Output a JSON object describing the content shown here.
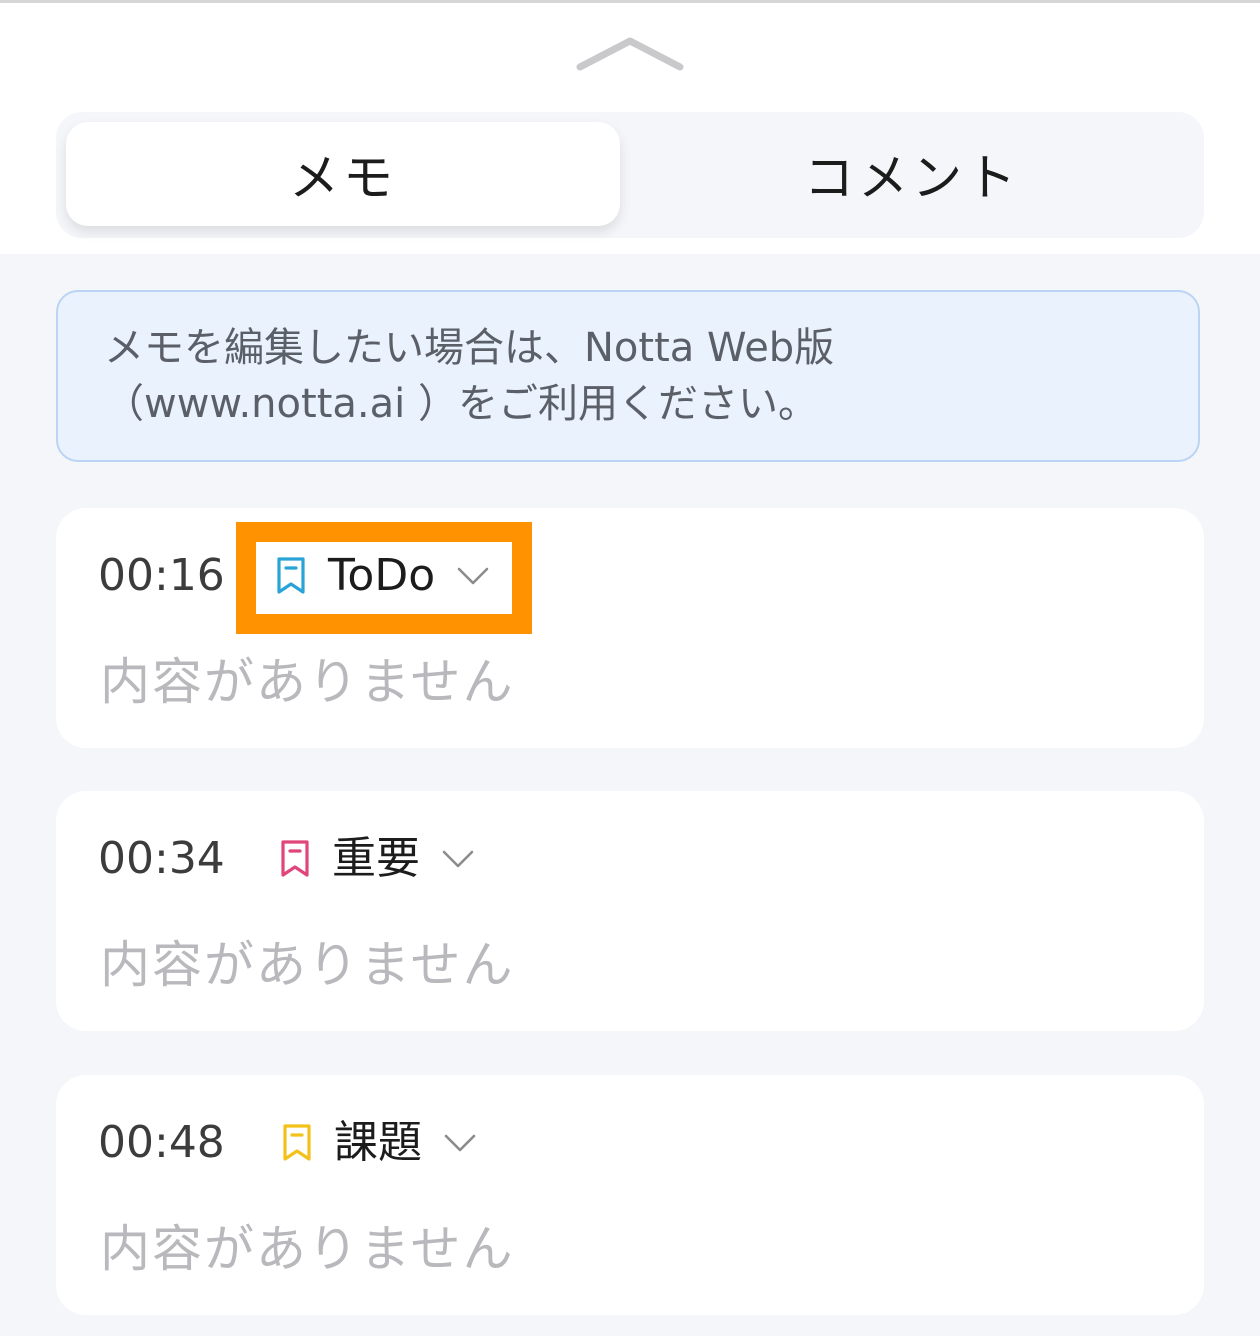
{
  "tabs": {
    "memo": "メモ",
    "comment": "コメント"
  },
  "notice": {
    "line1": "メモを編集したい場合は、Notta Web版",
    "line2": "（www.notta.ai ）をご利用ください。"
  },
  "memos": [
    {
      "time": "00:16",
      "tag": "ToDo",
      "tag_color": "#2aa3d6",
      "content": "内容がありません"
    },
    {
      "time": "00:34",
      "tag": "重要",
      "tag_color": "#e0457b",
      "content": "内容がありません"
    },
    {
      "time": "00:48",
      "tag": "課題",
      "tag_color": "#f2c21b",
      "content": "内容がありません"
    }
  ],
  "colors": {
    "highlight": "#ff9200",
    "notice_bg": "#eaf2fd",
    "page_bg": "#f4f6fa"
  },
  "icons": {
    "handle": "chevron-up-icon",
    "tag": "bookmark-icon",
    "dropdown": "chevron-down-icon"
  }
}
